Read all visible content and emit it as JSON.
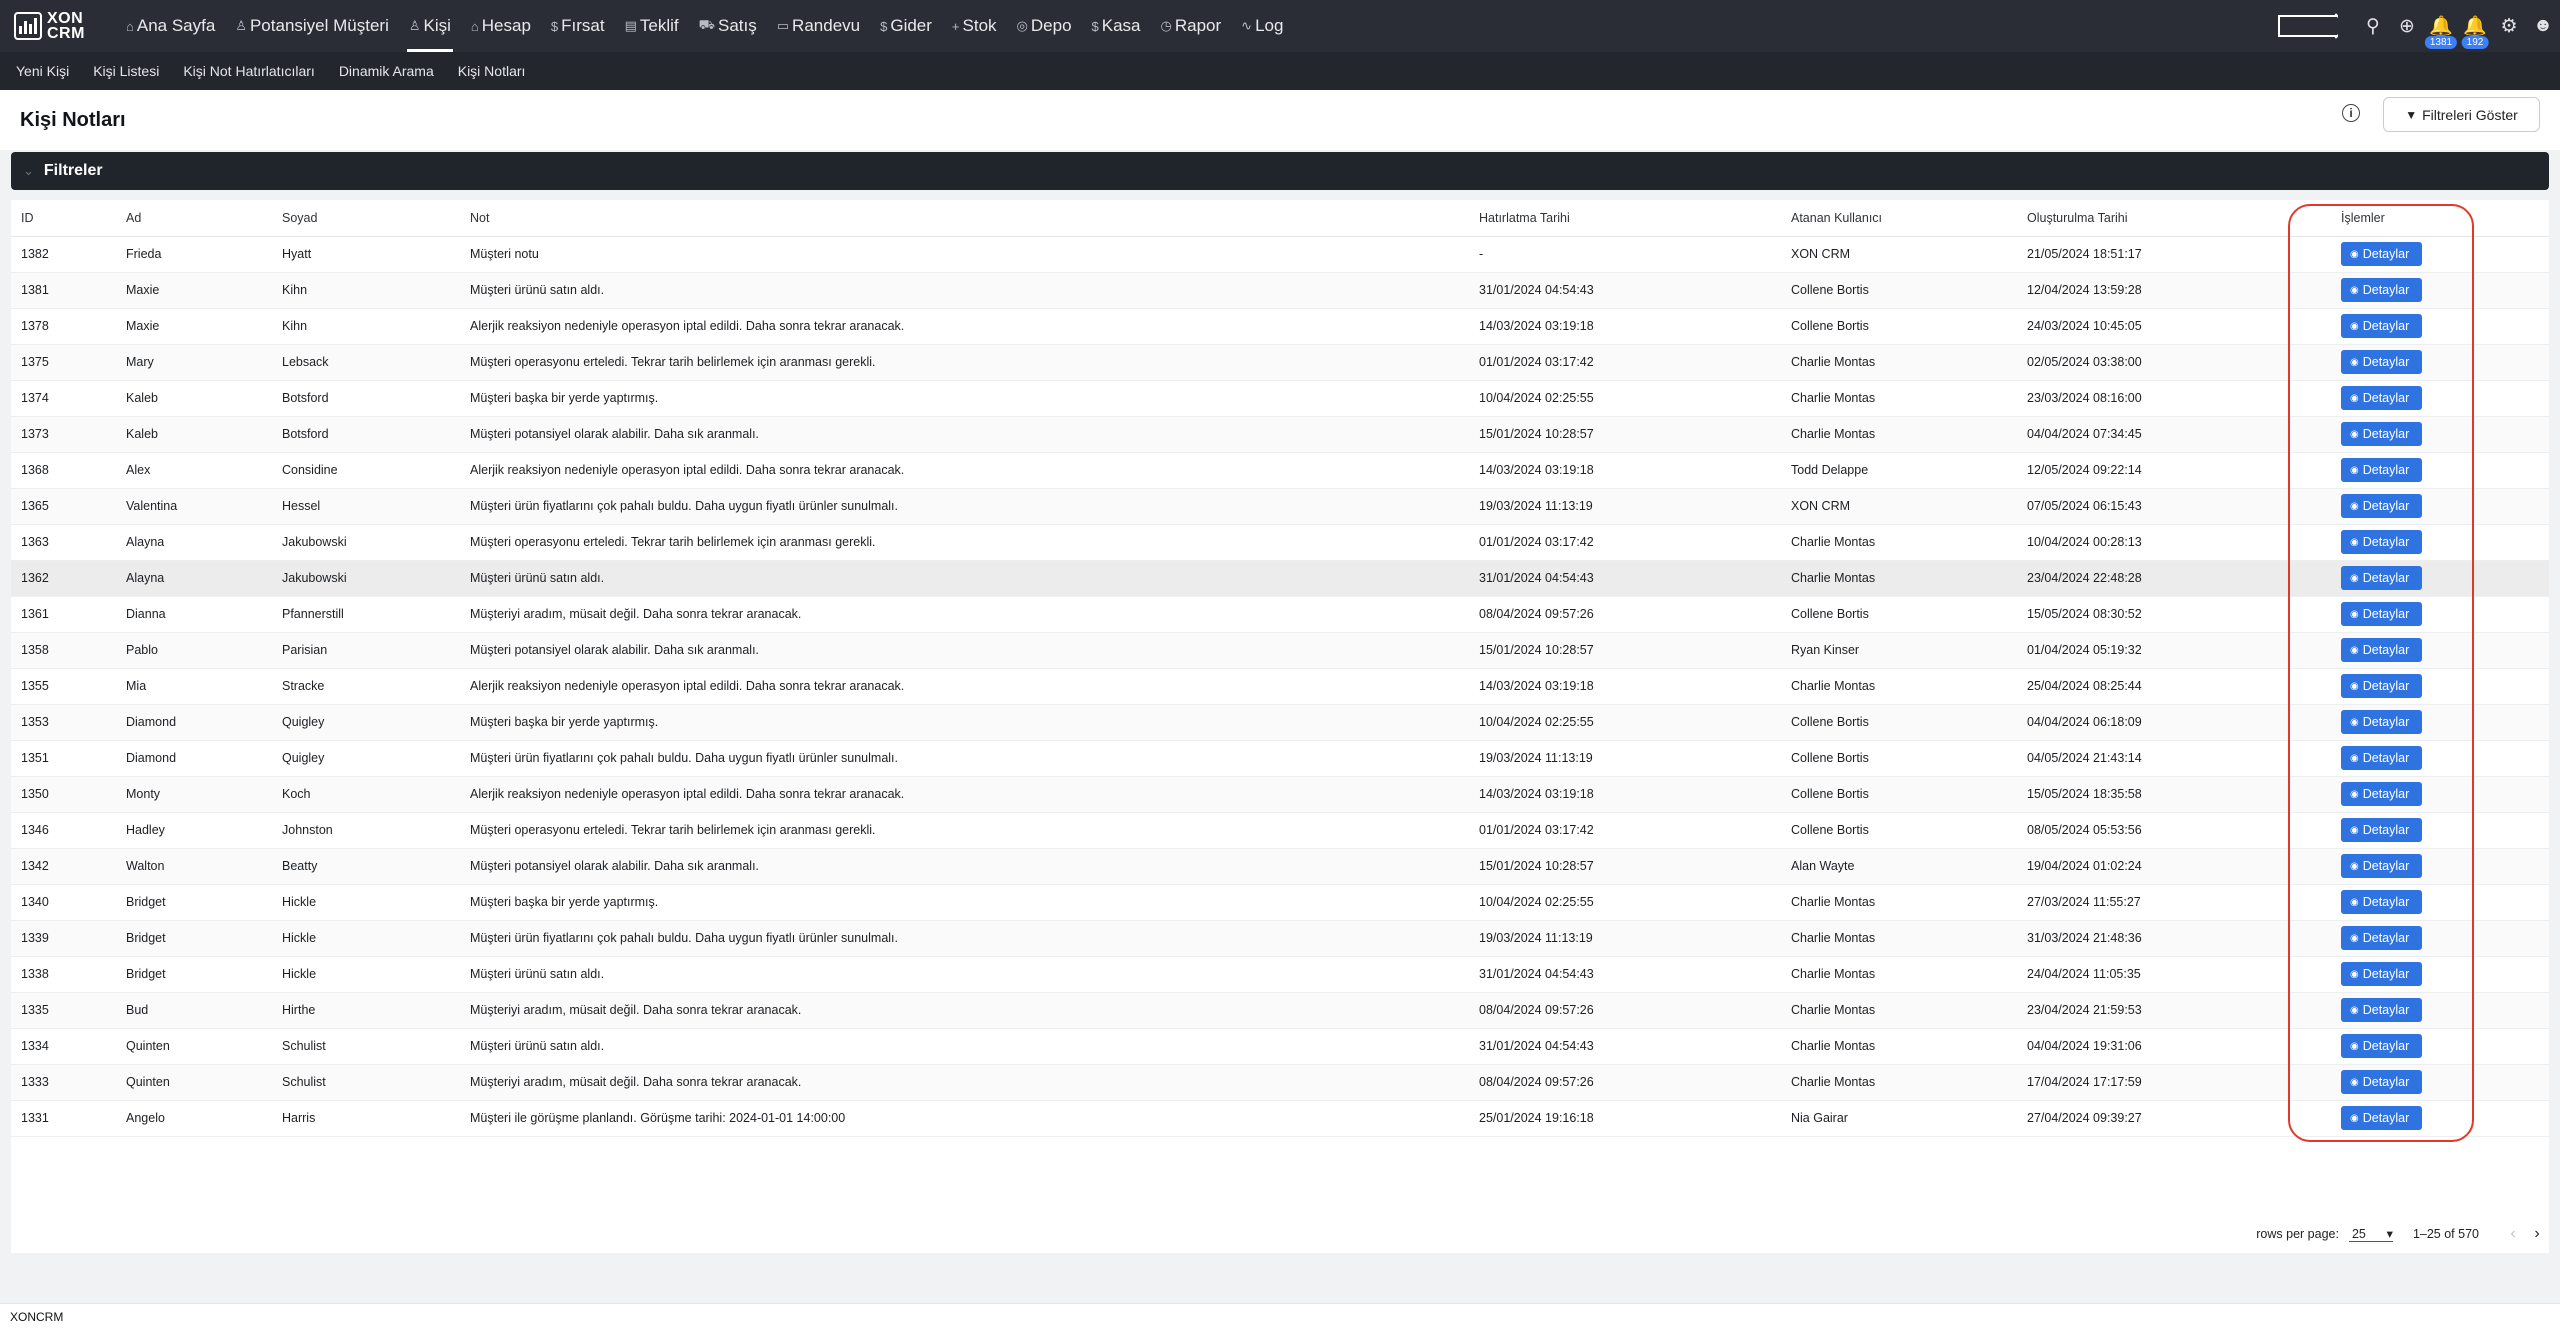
{
  "app": {
    "logo_line1": "XON",
    "logo_line2": "CRM"
  },
  "nav": [
    {
      "icon": "⌂",
      "label": "Ana Sayfa"
    },
    {
      "icon": "♙",
      "label": "Potansiyel Müşteri"
    },
    {
      "icon": "♙",
      "label": "Kişi",
      "active": true
    },
    {
      "icon": "⌂",
      "label": "Hesap"
    },
    {
      "icon": "$",
      "label": "Fırsat"
    },
    {
      "icon": "▤",
      "label": "Teklif"
    },
    {
      "icon": "⛟",
      "label": "Satış"
    },
    {
      "icon": "▭",
      "label": "Randevu"
    },
    {
      "icon": "$",
      "label": "Gider"
    },
    {
      "icon": "+",
      "label": "Stok"
    },
    {
      "icon": "◎",
      "label": "Depo"
    },
    {
      "icon": "$",
      "label": "Kasa"
    },
    {
      "icon": "◷",
      "label": "Rapor"
    },
    {
      "icon": "∿",
      "label": "Log"
    }
  ],
  "top_icons": {
    "badge1": "1381",
    "badge2": "192"
  },
  "subnav": [
    "Yeni Kişi",
    "Kişi Listesi",
    "Kişi Not Hatırlatıcıları",
    "Dinamik Arama",
    "Kişi Notları"
  ],
  "page": {
    "title": "Kişi Notları",
    "filter_button": "Filtreleri Göster",
    "filters_label": "Filtreler"
  },
  "table": {
    "headers": [
      "ID",
      "Ad",
      "Soyad",
      "Not",
      "Hatırlatma Tarihi",
      "Atanan Kullanıcı",
      "Oluşturulma Tarihi",
      "İşlemler"
    ],
    "action_label": "Detaylar",
    "rows": [
      [
        "1382",
        "Frieda",
        "Hyatt",
        "Müşteri notu",
        "-",
        "XON CRM",
        "21/05/2024 18:51:17"
      ],
      [
        "1381",
        "Maxie",
        "Kihn",
        "Müşteri ürünü satın aldı.",
        "31/01/2024 04:54:43",
        "Collene Bortis",
        "12/04/2024 13:59:28"
      ],
      [
        "1378",
        "Maxie",
        "Kihn",
        "Alerjik reaksiyon nedeniyle operasyon iptal edildi. Daha sonra tekrar aranacak.",
        "14/03/2024 03:19:18",
        "Collene Bortis",
        "24/03/2024 10:45:05"
      ],
      [
        "1375",
        "Mary",
        "Lebsack",
        "Müşteri operasyonu erteledi. Tekrar tarih belirlemek için aranması gerekli.",
        "01/01/2024 03:17:42",
        "Charlie Montas",
        "02/05/2024 03:38:00"
      ],
      [
        "1374",
        "Kaleb",
        "Botsford",
        "Müşteri başka bir yerde yaptırmış.",
        "10/04/2024 02:25:55",
        "Charlie Montas",
        "23/03/2024 08:16:00"
      ],
      [
        "1373",
        "Kaleb",
        "Botsford",
        "Müşteri potansiyel olarak alabilir. Daha sık aranmalı.",
        "15/01/2024 10:28:57",
        "Charlie Montas",
        "04/04/2024 07:34:45"
      ],
      [
        "1368",
        "Alex",
        "Considine",
        "Alerjik reaksiyon nedeniyle operasyon iptal edildi. Daha sonra tekrar aranacak.",
        "14/03/2024 03:19:18",
        "Todd Delappe",
        "12/05/2024 09:22:14"
      ],
      [
        "1365",
        "Valentina",
        "Hessel",
        "Müşteri ürün fiyatlarını çok pahalı buldu. Daha uygun fiyatlı ürünler sunulmalı.",
        "19/03/2024 11:13:19",
        "XON CRM",
        "07/05/2024 06:15:43"
      ],
      [
        "1363",
        "Alayna",
        "Jakubowski",
        "Müşteri operasyonu erteledi. Tekrar tarih belirlemek için aranması gerekli.",
        "01/01/2024 03:17:42",
        "Charlie Montas",
        "10/04/2024 00:28:13"
      ],
      [
        "1362",
        "Alayna",
        "Jakubowski",
        "Müşteri ürünü satın aldı.",
        "31/01/2024 04:54:43",
        "Charlie Montas",
        "23/04/2024 22:48:28"
      ],
      [
        "1361",
        "Dianna",
        "Pfannerstill",
        "Müşteriyi aradım, müsait değil. Daha sonra tekrar aranacak.",
        "08/04/2024 09:57:26",
        "Collene Bortis",
        "15/05/2024 08:30:52"
      ],
      [
        "1358",
        "Pablo",
        "Parisian",
        "Müşteri potansiyel olarak alabilir. Daha sık aranmalı.",
        "15/01/2024 10:28:57",
        "Ryan Kinser",
        "01/04/2024 05:19:32"
      ],
      [
        "1355",
        "Mia",
        "Stracke",
        "Alerjik reaksiyon nedeniyle operasyon iptal edildi. Daha sonra tekrar aranacak.",
        "14/03/2024 03:19:18",
        "Charlie Montas",
        "25/04/2024 08:25:44"
      ],
      [
        "1353",
        "Diamond",
        "Quigley",
        "Müşteri başka bir yerde yaptırmış.",
        "10/04/2024 02:25:55",
        "Collene Bortis",
        "04/04/2024 06:18:09"
      ],
      [
        "1351",
        "Diamond",
        "Quigley",
        "Müşteri ürün fiyatlarını çok pahalı buldu. Daha uygun fiyatlı ürünler sunulmalı.",
        "19/03/2024 11:13:19",
        "Collene Bortis",
        "04/05/2024 21:43:14"
      ],
      [
        "1350",
        "Monty",
        "Koch",
        "Alerjik reaksiyon nedeniyle operasyon iptal edildi. Daha sonra tekrar aranacak.",
        "14/03/2024 03:19:18",
        "Collene Bortis",
        "15/05/2024 18:35:58"
      ],
      [
        "1346",
        "Hadley",
        "Johnston",
        "Müşteri operasyonu erteledi. Tekrar tarih belirlemek için aranması gerekli.",
        "01/01/2024 03:17:42",
        "Collene Bortis",
        "08/05/2024 05:53:56"
      ],
      [
        "1342",
        "Walton",
        "Beatty",
        "Müşteri potansiyel olarak alabilir. Daha sık aranmalı.",
        "15/01/2024 10:28:57",
        "Alan Wayte",
        "19/04/2024 01:02:24"
      ],
      [
        "1340",
        "Bridget",
        "Hickle",
        "Müşteri başka bir yerde yaptırmış.",
        "10/04/2024 02:25:55",
        "Charlie Montas",
        "27/03/2024 11:55:27"
      ],
      [
        "1339",
        "Bridget",
        "Hickle",
        "Müşteri ürün fiyatlarını çok pahalı buldu. Daha uygun fiyatlı ürünler sunulmalı.",
        "19/03/2024 11:13:19",
        "Charlie Montas",
        "31/03/2024 21:48:36"
      ],
      [
        "1338",
        "Bridget",
        "Hickle",
        "Müşteri ürünü satın aldı.",
        "31/01/2024 04:54:43",
        "Charlie Montas",
        "24/04/2024 11:05:35"
      ],
      [
        "1335",
        "Bud",
        "Hirthe",
        "Müşteriyi aradım, müsait değil. Daha sonra tekrar aranacak.",
        "08/04/2024 09:57:26",
        "Charlie Montas",
        "23/04/2024 21:59:53"
      ],
      [
        "1334",
        "Quinten",
        "Schulist",
        "Müşteri ürünü satın aldı.",
        "31/01/2024 04:54:43",
        "Charlie Montas",
        "04/04/2024 19:31:06"
      ],
      [
        "1333",
        "Quinten",
        "Schulist",
        "Müşteriyi aradım, müsait değil. Daha sonra tekrar aranacak.",
        "08/04/2024 09:57:26",
        "Charlie Montas",
        "17/04/2024 17:17:59"
      ],
      [
        "1331",
        "Angelo",
        "Harris",
        "Müşteri ile görüşme planlandı. Görüşme tarihi: 2024-01-01 14:00:00",
        "25/01/2024 19:16:18",
        "Nia Gairar",
        "27/04/2024 09:39:27"
      ]
    ]
  },
  "pagination": {
    "rows_per_page_label": "rows per page:",
    "rows_per_page": "25",
    "range": "1–25 of 570"
  },
  "footer": {
    "text": "XONCRM"
  },
  "colors": {
    "topbar": "#2a2d35",
    "accent_button": "#2f73e0",
    "highlight_box": "#e0392c"
  }
}
